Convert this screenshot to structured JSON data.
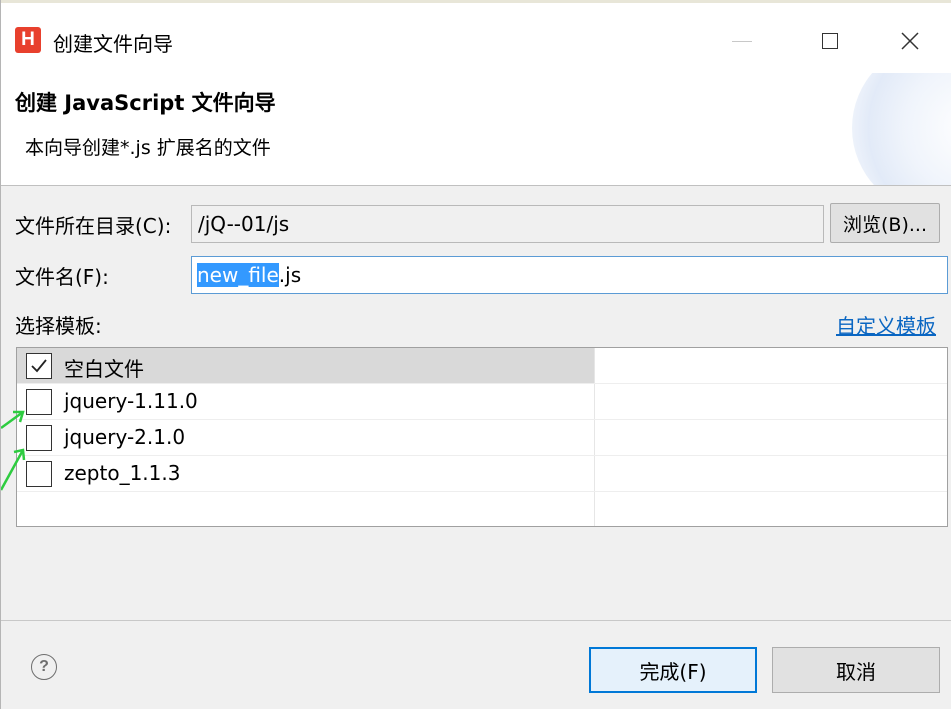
{
  "window": {
    "title": "创建文件向导",
    "logo_letter": "H",
    "accent_color": "#e8402d"
  },
  "header": {
    "title": "创建 JavaScript 文件向导",
    "subtitle": "本向导创建*.js 扩展名的文件"
  },
  "form": {
    "directory_label": "文件所在目录(C):",
    "directory_value": "/jQ--01/js",
    "browse_label": "浏览(B)...",
    "filename_label": "文件名(F):",
    "filename_selected": "new_file",
    "filename_suffix": ".js",
    "template_label": "选择模板:",
    "custom_template_link": "自定义模板"
  },
  "templates": [
    {
      "label": "空白文件",
      "checked": true
    },
    {
      "label": "jquery-1.11.0",
      "checked": false
    },
    {
      "label": "jquery-2.1.0",
      "checked": false
    },
    {
      "label": "zepto_1.1.3",
      "checked": false
    }
  ],
  "footer": {
    "help_icon": "question-icon",
    "finish_label": "完成(F)",
    "cancel_label": "取消",
    "focus_color": "#0078d7"
  },
  "annotation_color": "#2ecc40"
}
